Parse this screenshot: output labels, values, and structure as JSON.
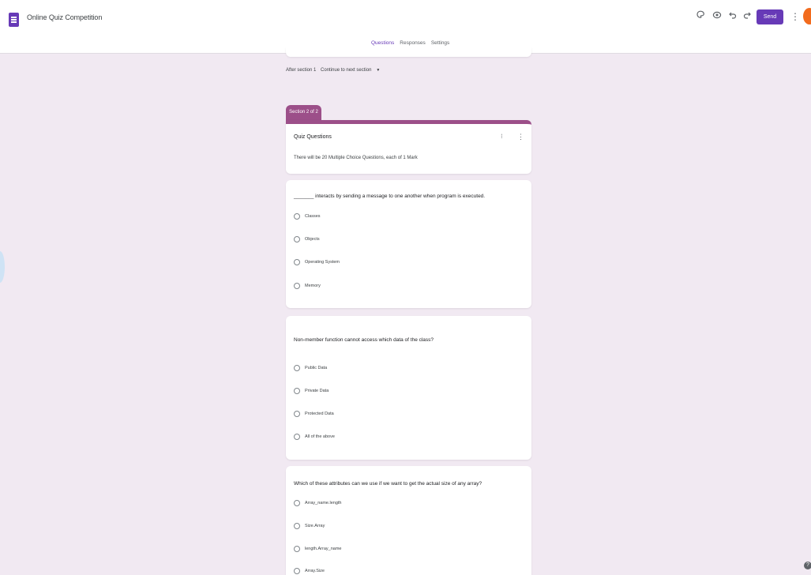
{
  "app": {
    "title": "Online Quiz Competition",
    "send_label": "Send",
    "icons": [
      "palette-icon",
      "preview-eye-icon",
      "undo-icon",
      "redo-icon",
      "more-vert-icon"
    ],
    "accent_color": "#673ab7"
  },
  "tabs": [
    {
      "label": "Questions",
      "active": true
    },
    {
      "label": "Responses",
      "active": false
    },
    {
      "label": "Settings",
      "active": false
    }
  ],
  "after_section": {
    "label": "After section 1",
    "value": "Continue to next section"
  },
  "section": {
    "badge": "Section 2 of 2",
    "title": "Quiz Questions",
    "description": "There will be 20 Multiple Choice Questions, each of 1 Mark"
  },
  "questions": [
    {
      "text": "_______ interacts by sending a message to one another when program is executed.",
      "options": [
        "Classes",
        "Objects",
        "Operating System",
        "Memory"
      ]
    },
    {
      "text": "Non-member function cannot access which data of the class?",
      "options": [
        "Public Data",
        "Private Data",
        "Protected Data",
        "All of the above"
      ]
    },
    {
      "text": "Which of these attributes can we use if we want to get the actual size of any array?",
      "options": [
        "Array_name.length",
        "Size.Array",
        "length.Array_name",
        "Array.Size"
      ]
    }
  ]
}
